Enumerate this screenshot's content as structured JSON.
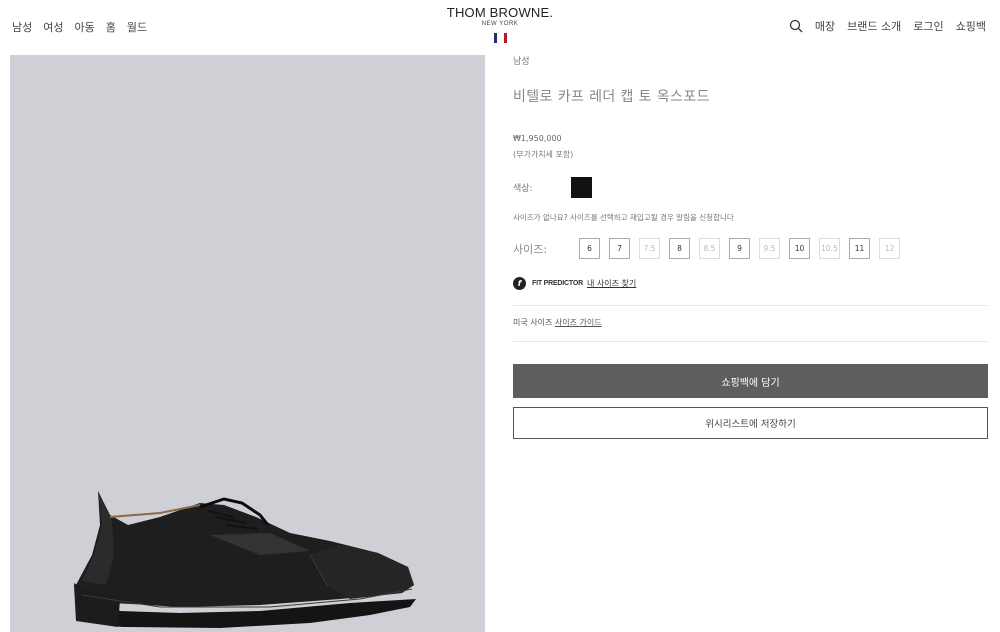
{
  "nav_left": [
    "남성",
    "여성",
    "아동",
    "홈",
    "월드"
  ],
  "logo": {
    "main": "THOM BROWNE.",
    "sub": "NEW YORK"
  },
  "flag_colors": [
    "#1f2f6b",
    "#ffffff",
    "#b01e2a"
  ],
  "nav_right": {
    "store": "매장",
    "about": "브랜드 소개",
    "login": "로그인",
    "bag": "쇼핑백"
  },
  "product": {
    "category": "남성",
    "title": "비텔로 카프 레더 캡 토 옥스포드",
    "price": "₩1,950,000",
    "vat_note": "(부가가치세 포함)",
    "color_label": "색상:",
    "color_swatch": "#111111",
    "size_note": "사이즈가 없나요? 사이즈를 선택하고 재입고될 경우 알림을 신청합니다",
    "size_label": "사이즈:",
    "sizes": [
      {
        "label": "6",
        "available": true
      },
      {
        "label": "7",
        "available": true
      },
      {
        "label": "7.5",
        "available": false
      },
      {
        "label": "8",
        "available": true
      },
      {
        "label": "8.5",
        "available": false
      },
      {
        "label": "9",
        "available": true
      },
      {
        "label": "9.5",
        "available": false
      },
      {
        "label": "10",
        "available": true
      },
      {
        "label": "10.5",
        "available": false
      },
      {
        "label": "11",
        "available": true
      },
      {
        "label": "12",
        "available": false
      }
    ],
    "fit_predictor": {
      "label": "FIT PREDICTOR",
      "link": "내 사이즈 찾기"
    },
    "size_guide": {
      "prefix": "미국 사이즈",
      "link": "사이즈 가이드"
    },
    "add_to_bag": "쇼핑백에 담기",
    "wishlist": "위시리스트에 저장하기"
  },
  "image_background": "#cfd0d6"
}
